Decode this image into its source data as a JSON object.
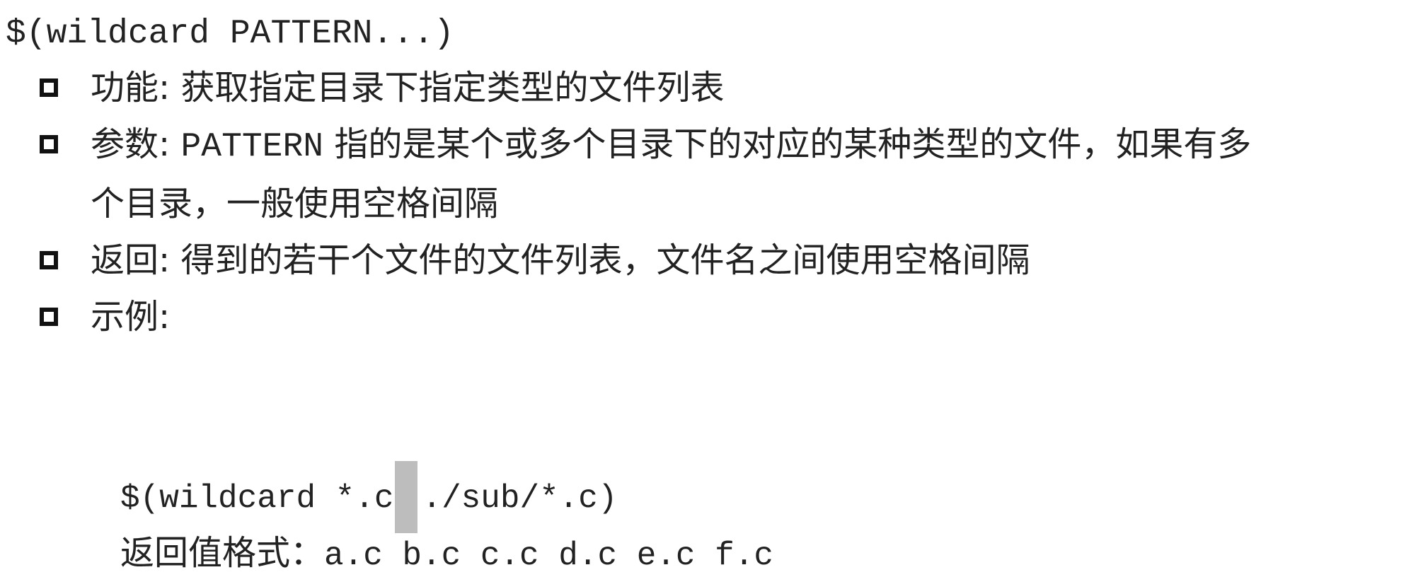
{
  "heading": "$(wildcard PATTERN...)",
  "bullets": {
    "function": {
      "label": "功能",
      "separator": ":",
      "text": "获取指定目录下指定类型的文件列表"
    },
    "parameter": {
      "label": "参数",
      "separator": ":",
      "keyword": "PATTERN",
      "text": "指的是某个或多个目录下的对应的某种类型的文件，如果有多",
      "continuation": "个目录，一般使用空格间隔"
    },
    "return": {
      "label": "返回",
      "separator": ":",
      "text": "得到的若干个文件的文件列表，文件名之间使用空格间隔"
    },
    "example": {
      "label": "示例",
      "separator": ":"
    }
  },
  "example_code": {
    "part1": "$(wildcard *.c",
    "part2": "./sub/*.c)"
  },
  "return_format": {
    "label": "返回值格式：",
    "value": "a.c b.c c.c d.c e.c f.c"
  }
}
